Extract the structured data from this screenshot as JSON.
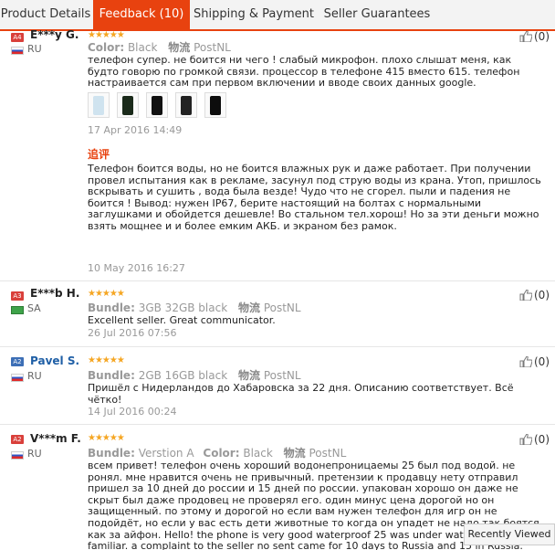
{
  "tabs": [
    {
      "label": "Product Details",
      "active": false
    },
    {
      "label": "Feedback (10)",
      "active": true
    },
    {
      "label": "Shipping & Payment",
      "active": false
    },
    {
      "label": "Seller Guarantees",
      "active": false
    }
  ],
  "reviews": [
    {
      "level": "A4",
      "name": "E***y G.",
      "country": "RU",
      "stars": "★★★★★",
      "attr1_label": "Color:",
      "attr1_value": "Black",
      "logistics_label": "物流",
      "logistics_value": "PostNL",
      "helpful": "(0)",
      "text": "телефон супер. не боится ни чего ! слабый микрофон. плохо слышат меня, как будто говорю по громкой связи. процессор в телефоне 415 вместо 615. телефон настраивается сам при первом включении и вводе своих данных google.",
      "date": "17 Apr 2016 14:49",
      "additional_label": "追评",
      "additional_text": "Телефон боится воды, но не боится влажных рук и даже работает. При получении провел испытания как в рекламе, засунул под струю воды из крана. Утоп, пришлось вскрывать и сушить , вода была везде! Чудо что не сгорел. пыли и падения не боится ! Вывод: нужен IP67, берите настоящий на болтах с нормальными заглушками и обойдется дешевле! Во стальном тел.хорош! Но за эти деньги можно взять мощнее и и более емким АКБ. и экраном без рамок.",
      "additional_date": "10 May 2016 16:27"
    },
    {
      "level": "A3",
      "name": "E***b H.",
      "country": "SA",
      "stars": "★★★★★",
      "attr1_label": "Bundle:",
      "attr1_value": "3GB 32GB black",
      "logistics_label": "物流",
      "logistics_value": "PostNL",
      "helpful": "(0)",
      "text": "Excellent seller. Great communicator.",
      "date": "26 Jul 2016 07:56"
    },
    {
      "level": "A2",
      "name": "Pavel S.",
      "country": "RU",
      "stars": "★★★★★",
      "attr1_label": "Bundle:",
      "attr1_value": "2GB 16GB black",
      "logistics_label": "物流",
      "logistics_value": "PostNL",
      "helpful": "(0)",
      "text": "Пришёл с Нидерландов до Хабаровска за 22 дня. Описанию соответствует. Всё чётко!",
      "date": "14 Jul 2016 00:24"
    },
    {
      "level": "A2",
      "name": "V***m F.",
      "country": "RU",
      "stars": "★★★★★",
      "attr1_label": "Bundle:",
      "attr1_value": "Verstion A",
      "attr2_label": "Color:",
      "attr2_value": "Black",
      "logistics_label": "物流",
      "logistics_value": "PostNL",
      "helpful": "(0)",
      "text": "всем привет! телефон очень хороший водонепроницаемы 25 был под водой. не ронял. мне нравится очень не привычный. претензии к продавцу нету отправил пришел за 10 дней до россии и 15 дней по россии. упакован хорошо он даже не скрыт был даже продовец не проверял его. один минус цена дорогой но он защищенный. по этому и дорогой но если вам нужен телефон для игр он не подойдёт, но если у вас есть дети животные то когда он упадет не надо так боятся как за айфон. Hello! the phone is very good waterproof 25 was under water I like very familiar. a complaint to the seller no sent came for 10 days to Russia and 15 in Russia. are. Packed well he's not even hidden was even the seller didn't check"
    }
  ],
  "recently_viewed": "Recently Viewed"
}
